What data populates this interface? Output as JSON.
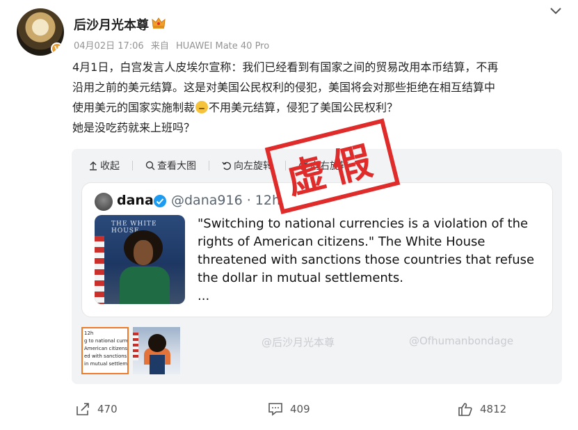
{
  "post": {
    "username": "后沙月光本尊",
    "verified_badge": "V",
    "date": "04月02日 17:06",
    "source_prefix": "来自",
    "source_device": "HUAWEI Mate 40 Pro",
    "text_line1": "4月1日，白宫发言人皮埃尔宣称：我们已经看到有国家之间的贸易改用本币结算，不再",
    "text_line2": "沿用之前的美元结算。这是对美国公民权利的侵犯，美国将会对那些拒绝在相互结算中",
    "text_line3a": "使用美元的国家实施制裁",
    "text_line3b": "不用美元结算，侵犯了美国公民权利？",
    "text_line4": "她是没吃药就来上班吗？"
  },
  "toolbar": {
    "collapse": "收起",
    "view_large": "查看大图",
    "rotate_left": "向左旋转",
    "rotate_right": "向右旋转"
  },
  "tweet": {
    "name": "dana",
    "handle": "@dana916 · 12h",
    "image_sign": "THE WHITE HOUSE",
    "text": "\"Switching to national currencies is a violation of the rights of American citizens.\" The White House threatened with sanctions those countries that refuse the dollar in mutual settlements.",
    "ellipsis": "..."
  },
  "watermarks": {
    "left": "@后沙月光本尊",
    "right": "@Ofhumanbondage"
  },
  "thumbnail1": {
    "time": "12h",
    "text": "g to national curren American citizens.\" T ed with sanctions th r in mutual settleme"
  },
  "stamp": {
    "text": "虚假"
  },
  "actions": {
    "share_count": "470",
    "comment_count": "409",
    "like_count": "4812"
  },
  "colors": {
    "stamp_red": "#e02b2b",
    "accent_orange": "#f07a29",
    "verified_blue": "#1d9bf0",
    "meta_gray": "#939393"
  }
}
